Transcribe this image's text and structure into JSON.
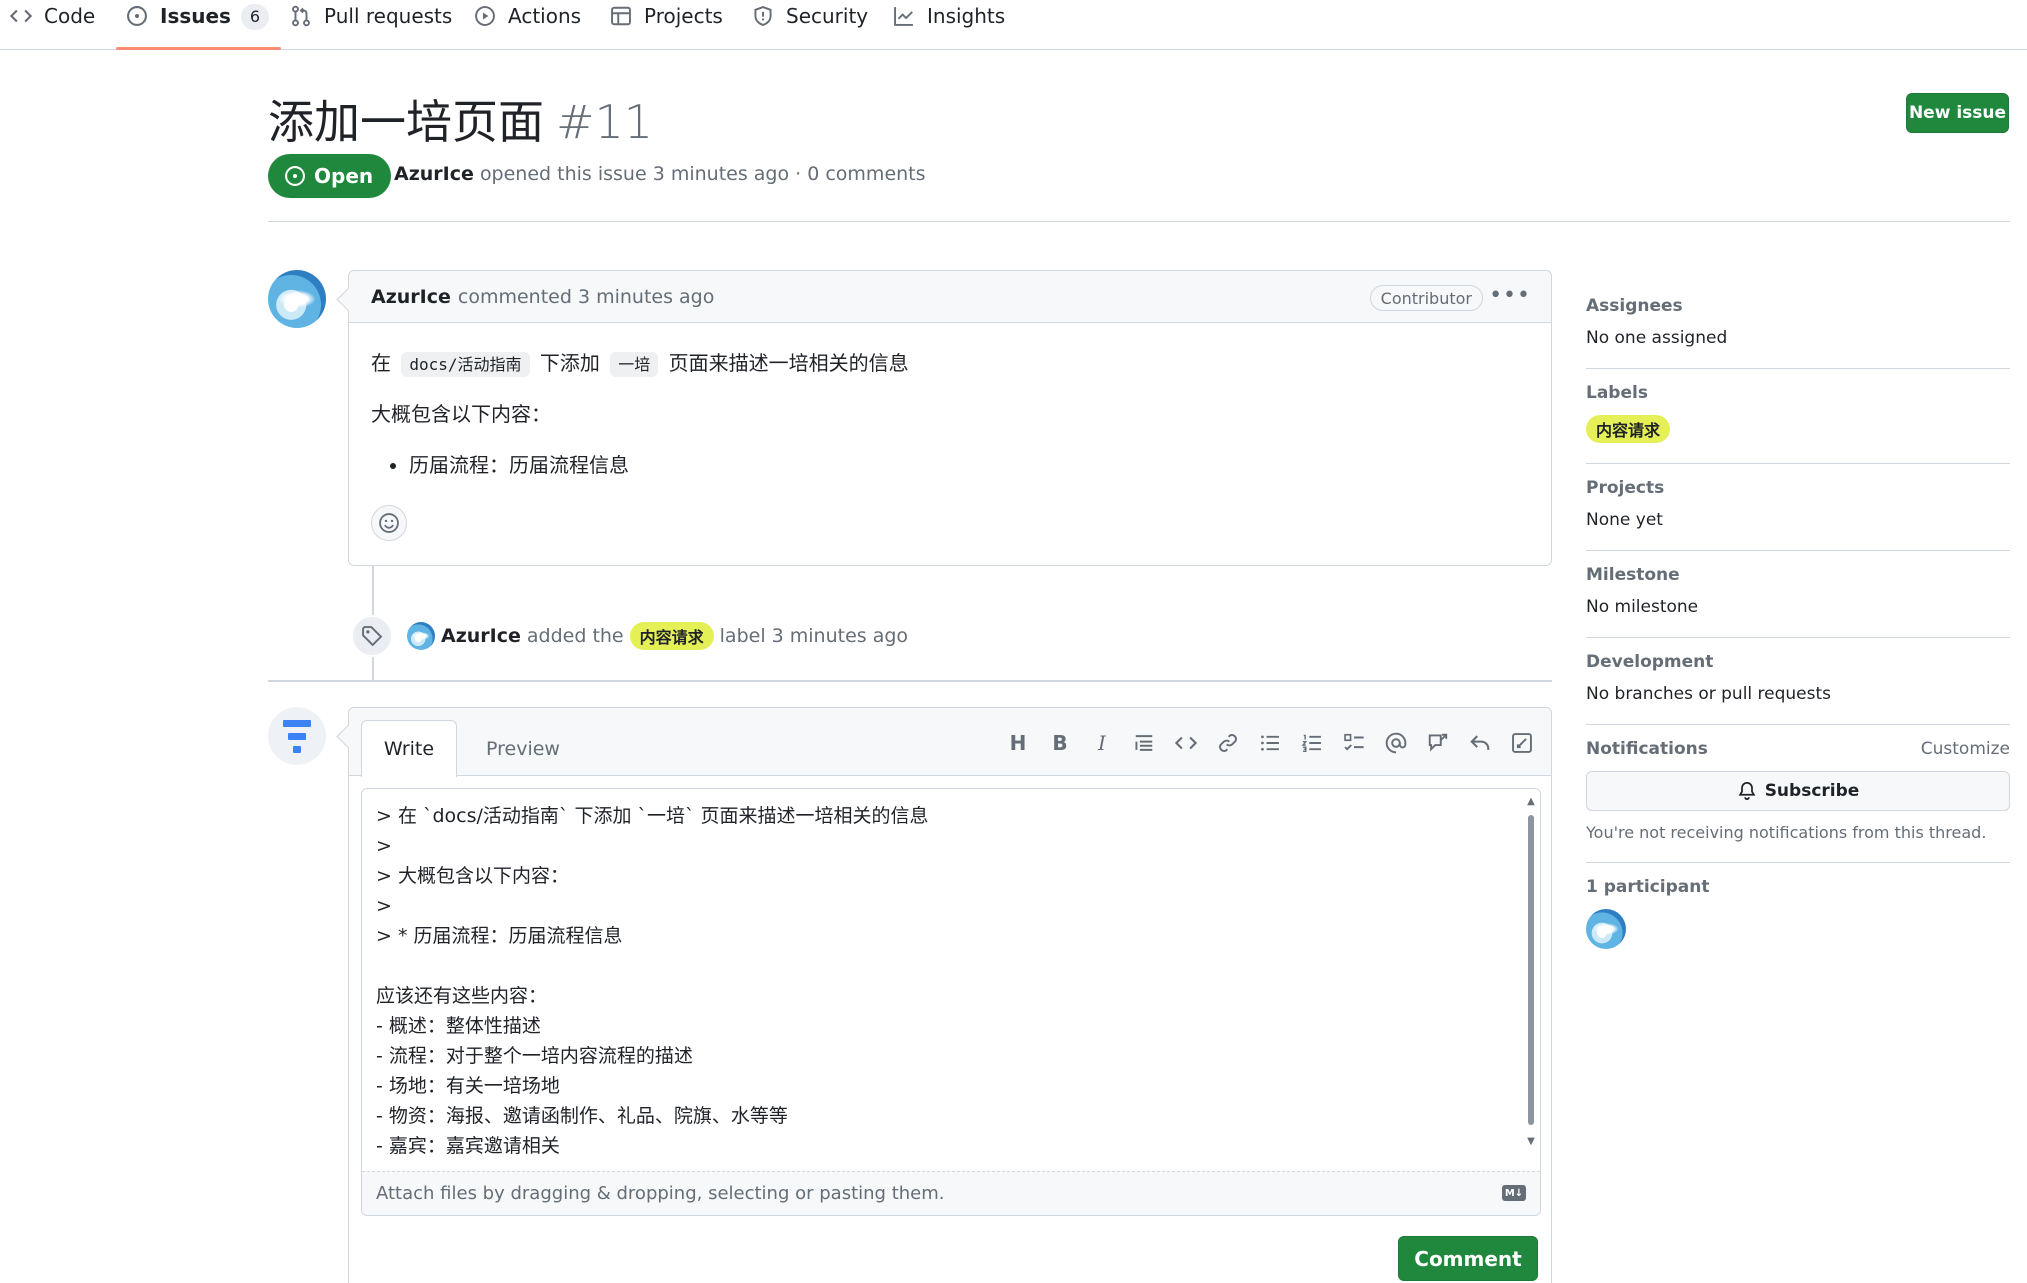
{
  "repo_nav": {
    "tabs": [
      {
        "label": "Code",
        "icon": "code-icon"
      },
      {
        "label": "Issues",
        "icon": "issue-opened-icon",
        "count": "6",
        "selected": true
      },
      {
        "label": "Pull requests",
        "icon": "git-pull-request-icon"
      },
      {
        "label": "Actions",
        "icon": "play-icon"
      },
      {
        "label": "Projects",
        "icon": "table-icon"
      },
      {
        "label": "Security",
        "icon": "shield-icon"
      },
      {
        "label": "Insights",
        "icon": "graph-icon"
      }
    ]
  },
  "issue": {
    "title": "添加一培页面",
    "number": "#11",
    "state": "Open",
    "author": "AzurIce",
    "meta_text": "opened this issue 3 minutes ago · 0 comments",
    "new_issue_label": "New issue"
  },
  "comment": {
    "author": "AzurIce",
    "time_text": "commented 3 minutes ago",
    "role_badge": "Contributor",
    "body": {
      "line1_prefix": "在",
      "code1": "docs/活动指南",
      "line1_mid": "下添加",
      "code2": "一培",
      "line1_suffix": "页面来描述一培相关的信息",
      "line2": "大概包含以下内容：",
      "bullet1": "历届流程：历届流程信息"
    }
  },
  "timeline_event": {
    "actor": "AzurIce",
    "verb": "added the",
    "label": "内容请求",
    "suffix": "label 3 minutes ago"
  },
  "composer": {
    "tab_write": "Write",
    "tab_preview": "Preview",
    "toolbar": [
      "heading-icon",
      "bold-icon",
      "italic-icon",
      "quote-icon",
      "code-icon",
      "link-icon",
      "unordered-list-icon",
      "ordered-list-icon",
      "task-list-icon",
      "mention-icon",
      "cross-reference-icon",
      "reply-icon",
      "fullscreen-icon"
    ],
    "text": "> 在 `docs/活动指南` 下添加 `一培` 页面来描述一培相关的信息\n>\n> 大概包含以下内容：\n>\n> * 历届流程：历届流程信息\n\n应该还有这些内容：\n- 概述：整体性描述\n- 流程：对于整个一培内容流程的描述\n- 场地：有关一培场地\n- 物资：海报、邀请函制作、礼品、院旗、水等等\n- 嘉宾：嘉宾邀请相关",
    "attach_hint": "Attach files by dragging & dropping, selecting or pasting them.",
    "markdown_badge": "M↓",
    "submit_label": "Comment"
  },
  "sidebar": {
    "assignees": {
      "title": "Assignees",
      "value": "No one assigned"
    },
    "labels": {
      "title": "Labels",
      "value": "内容请求"
    },
    "projects": {
      "title": "Projects",
      "value": "None yet"
    },
    "milestone": {
      "title": "Milestone",
      "value": "No milestone"
    },
    "development": {
      "title": "Development",
      "value": "No branches or pull requests"
    },
    "notifications": {
      "title": "Notifications",
      "customize": "Customize",
      "subscribe": "Subscribe",
      "note": "You're not receiving notifications from this thread."
    },
    "participants": {
      "title": "1 participant"
    }
  },
  "colors": {
    "accent_green": "#1f883d",
    "label_yellow": "#e5f056",
    "nav_underline": "#fd8c73",
    "border": "#d0d7de",
    "muted_text": "#656d76"
  }
}
